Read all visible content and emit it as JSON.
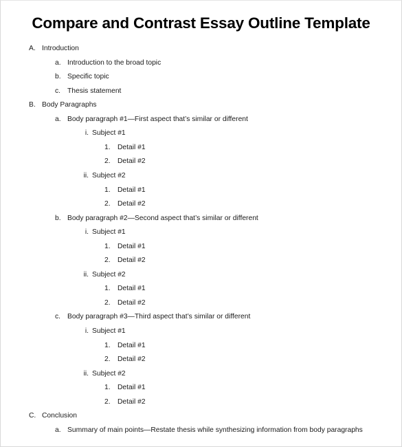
{
  "document": {
    "title": "Compare and Contrast Essay Outline Template",
    "outline": [
      {
        "level": 1,
        "marker": "A.",
        "text": "Introduction"
      },
      {
        "level": 2,
        "marker": "a.",
        "text": "Introduction to the broad topic"
      },
      {
        "level": 2,
        "marker": "b.",
        "text": "Specific topic"
      },
      {
        "level": 2,
        "marker": "c.",
        "text": "Thesis statement"
      },
      {
        "level": 1,
        "marker": "B.",
        "text": "Body Paragraphs"
      },
      {
        "level": 2,
        "marker": "a.",
        "text": "Body paragraph #1—First aspect that’s similar or different"
      },
      {
        "level": 3,
        "marker": "i.",
        "text": "Subject #1"
      },
      {
        "level": 4,
        "marker": "1.",
        "text": "Detail #1"
      },
      {
        "level": 4,
        "marker": "2.",
        "text": "Detail #2"
      },
      {
        "level": 3,
        "marker": "ii.",
        "text": "Subject #2"
      },
      {
        "level": 4,
        "marker": "1.",
        "text": "Detail #1"
      },
      {
        "level": 4,
        "marker": "2.",
        "text": "Detail #2"
      },
      {
        "level": 2,
        "marker": "b.",
        "text": "Body paragraph #2—Second aspect that’s similar or different"
      },
      {
        "level": 3,
        "marker": "i.",
        "text": "Subject #1"
      },
      {
        "level": 4,
        "marker": "1.",
        "text": "Detail #1"
      },
      {
        "level": 4,
        "marker": "2.",
        "text": "Detail #2"
      },
      {
        "level": 3,
        "marker": "ii.",
        "text": "Subject #2"
      },
      {
        "level": 4,
        "marker": "1.",
        "text": "Detail #1"
      },
      {
        "level": 4,
        "marker": "2.",
        "text": "Detail #2"
      },
      {
        "level": 2,
        "marker": "c.",
        "text": "Body paragraph #3—Third aspect that’s similar or different"
      },
      {
        "level": 3,
        "marker": "i.",
        "text": "Subject #1"
      },
      {
        "level": 4,
        "marker": "1.",
        "text": "Detail #1"
      },
      {
        "level": 4,
        "marker": "2.",
        "text": "Detail #2"
      },
      {
        "level": 3,
        "marker": "ii.",
        "text": "Subject #2"
      },
      {
        "level": 4,
        "marker": "1.",
        "text": "Detail #1"
      },
      {
        "level": 4,
        "marker": "2.",
        "text": "Detail #2"
      },
      {
        "level": 1,
        "marker": "C.",
        "text": "Conclusion"
      },
      {
        "level": 2,
        "marker": "a.",
        "text": "Summary of main points—Restate thesis while synthesizing information from body paragraphs"
      }
    ]
  }
}
